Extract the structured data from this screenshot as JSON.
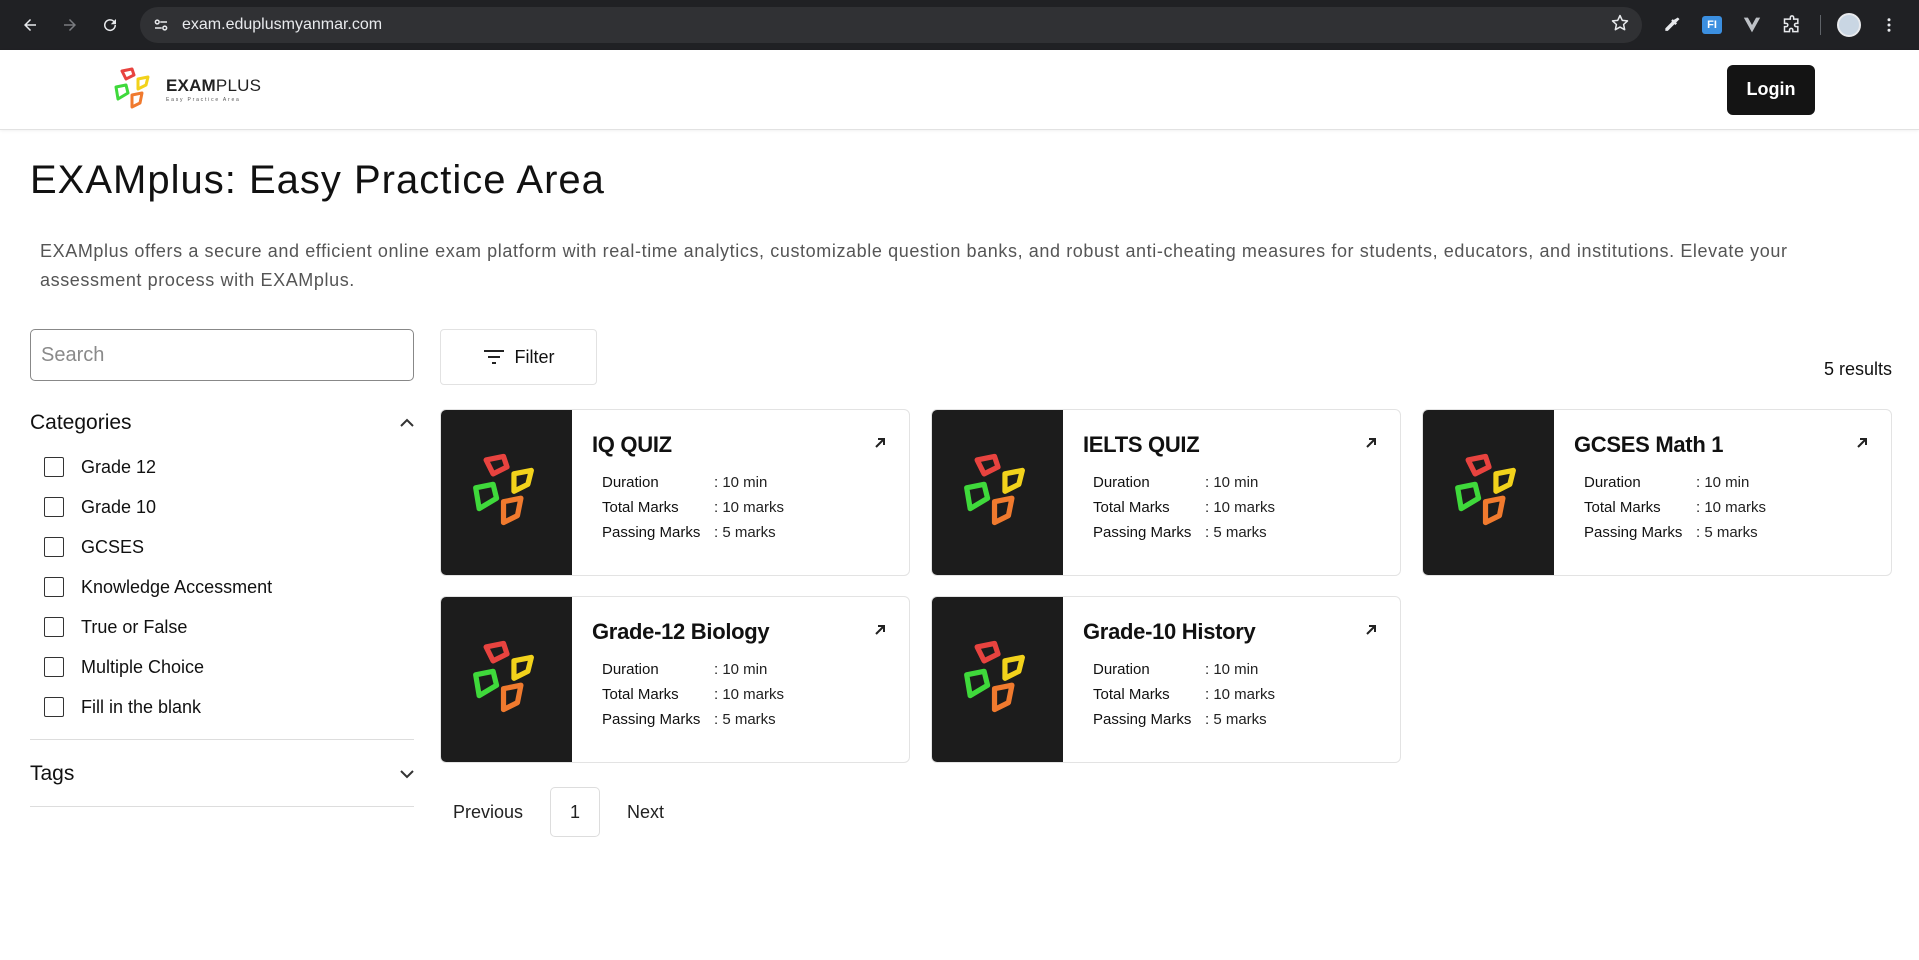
{
  "browser": {
    "url": "exam.eduplusmyanmar.com",
    "ext_label": "FI"
  },
  "header": {
    "logo_name_bold": "EXAM",
    "logo_name_thin": "PLUS",
    "logo_tagline": "Easy Practice Area",
    "login_label": "Login"
  },
  "page": {
    "title": "EXAMplus: Easy Practice Area",
    "description": "EXAMplus offers a secure and efficient online exam platform with real-time analytics, customizable question banks, and robust anti-cheating measures for students, educators, and institutions. Elevate your assessment process with EXAMplus."
  },
  "sidebar": {
    "search_placeholder": "Search",
    "categories_title": "Categories",
    "categories": [
      {
        "label": "Grade 12"
      },
      {
        "label": "Grade 10"
      },
      {
        "label": "GCSES"
      },
      {
        "label": "Knowledge Accessment"
      },
      {
        "label": "True or False"
      },
      {
        "label": "Multiple Choice"
      },
      {
        "label": "Fill in the blank"
      }
    ],
    "tags_title": "Tags"
  },
  "results": {
    "filter_label": "Filter",
    "count_label": "5 results",
    "meta_labels": {
      "duration": "Duration",
      "total": "Total Marks",
      "passing": "Passing Marks"
    },
    "quizzes": [
      {
        "title": "IQ QUIZ",
        "duration": ": 10 min",
        "total": ": 10 marks",
        "passing": ": 5 marks"
      },
      {
        "title": "IELTS QUIZ",
        "duration": ": 10 min",
        "total": ": 10 marks",
        "passing": ": 5 marks"
      },
      {
        "title": "GCSES Math 1",
        "duration": ": 10 min",
        "total": ": 10 marks",
        "passing": ": 5 marks"
      },
      {
        "title": "Grade-12 Biology",
        "duration": ": 10 min",
        "total": ": 10 marks",
        "passing": ": 5 marks"
      },
      {
        "title": "Grade-10 History",
        "duration": ": 10 min",
        "total": ": 10 marks",
        "passing": ": 5 marks"
      }
    ]
  },
  "pagination": {
    "previous_label": "Previous",
    "current_page": "1",
    "next_label": "Next"
  },
  "colors": {
    "brand_red": "#e8433f",
    "brand_yellow": "#f2d21b",
    "brand_green": "#3fd93b",
    "brand_orange": "#f07a2e",
    "button_dark": "#141414"
  }
}
